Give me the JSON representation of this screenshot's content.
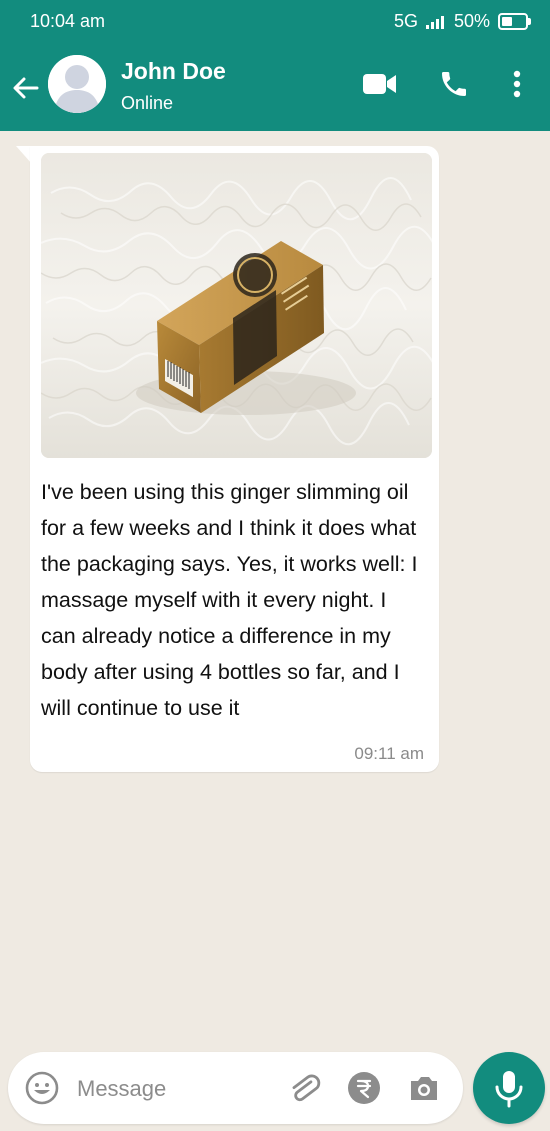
{
  "status_bar": {
    "time": "10:04 am",
    "network": "5G",
    "battery": "50%"
  },
  "header": {
    "contact_name": "John Doe",
    "contact_status": "Online",
    "icons": [
      "back-arrow-icon",
      "video-call-icon",
      "phone-icon",
      "more-options-icon"
    ]
  },
  "chat": {
    "message": {
      "text": " I've been using this ginger slimming oil for a few weeks and I think it does what the packaging says. Yes, it works well: I massage myself with it every night. I can already notice a difference in my body after using 4 bottles so far, and I will continue to use it",
      "time": "09:11 am"
    }
  },
  "composer": {
    "placeholder": "Message",
    "icons": [
      "emoji-icon",
      "attachment-icon",
      "rupee-payment-icon",
      "camera-icon",
      "mic-icon"
    ]
  },
  "colors": {
    "primary": "#128c7e",
    "chat_background": "#efeae2",
    "bubble": "#ffffff"
  }
}
